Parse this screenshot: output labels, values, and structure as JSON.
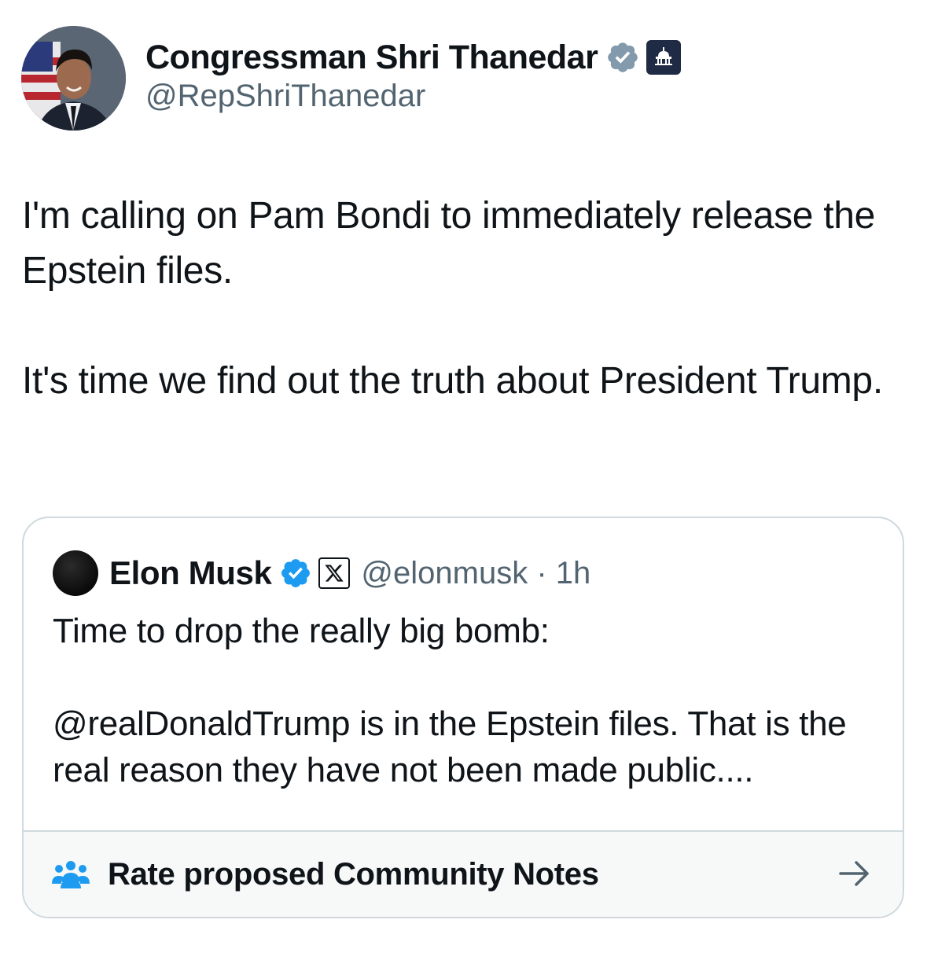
{
  "author": {
    "display_name": "Congressman Shri Thanedar",
    "handle": "@RepShriThanedar",
    "verified_badge": "grey-verified-badge-icon",
    "affiliation_badge": "capitol-icon"
  },
  "tweet": {
    "text": "I'm calling on Pam Bondi to immediately release the Epstein files.\n\nIt's time we find out the truth about President Trump."
  },
  "quoted_tweet": {
    "display_name": "Elon Musk",
    "verified_badge": "blue-verified-badge-icon",
    "affiliation_badge": "x-logo-icon",
    "handle_time": "@elonmusk · 1h",
    "text": "Time to drop the really big bomb:\n\n@realDonaldTrump is in the Epstein files. That is the real reason they have not been made public....",
    "community_notes": {
      "label": "Rate proposed Community Notes",
      "icon": "people-icon",
      "arrow": "arrow-right-icon"
    }
  },
  "colors": {
    "text_primary": "#0f1419",
    "text_secondary": "#536471",
    "verified_blue": "#1d9bf0",
    "verified_grey": "#829aab",
    "border": "#cfd9de",
    "notes_bg": "#f7f9f9"
  }
}
